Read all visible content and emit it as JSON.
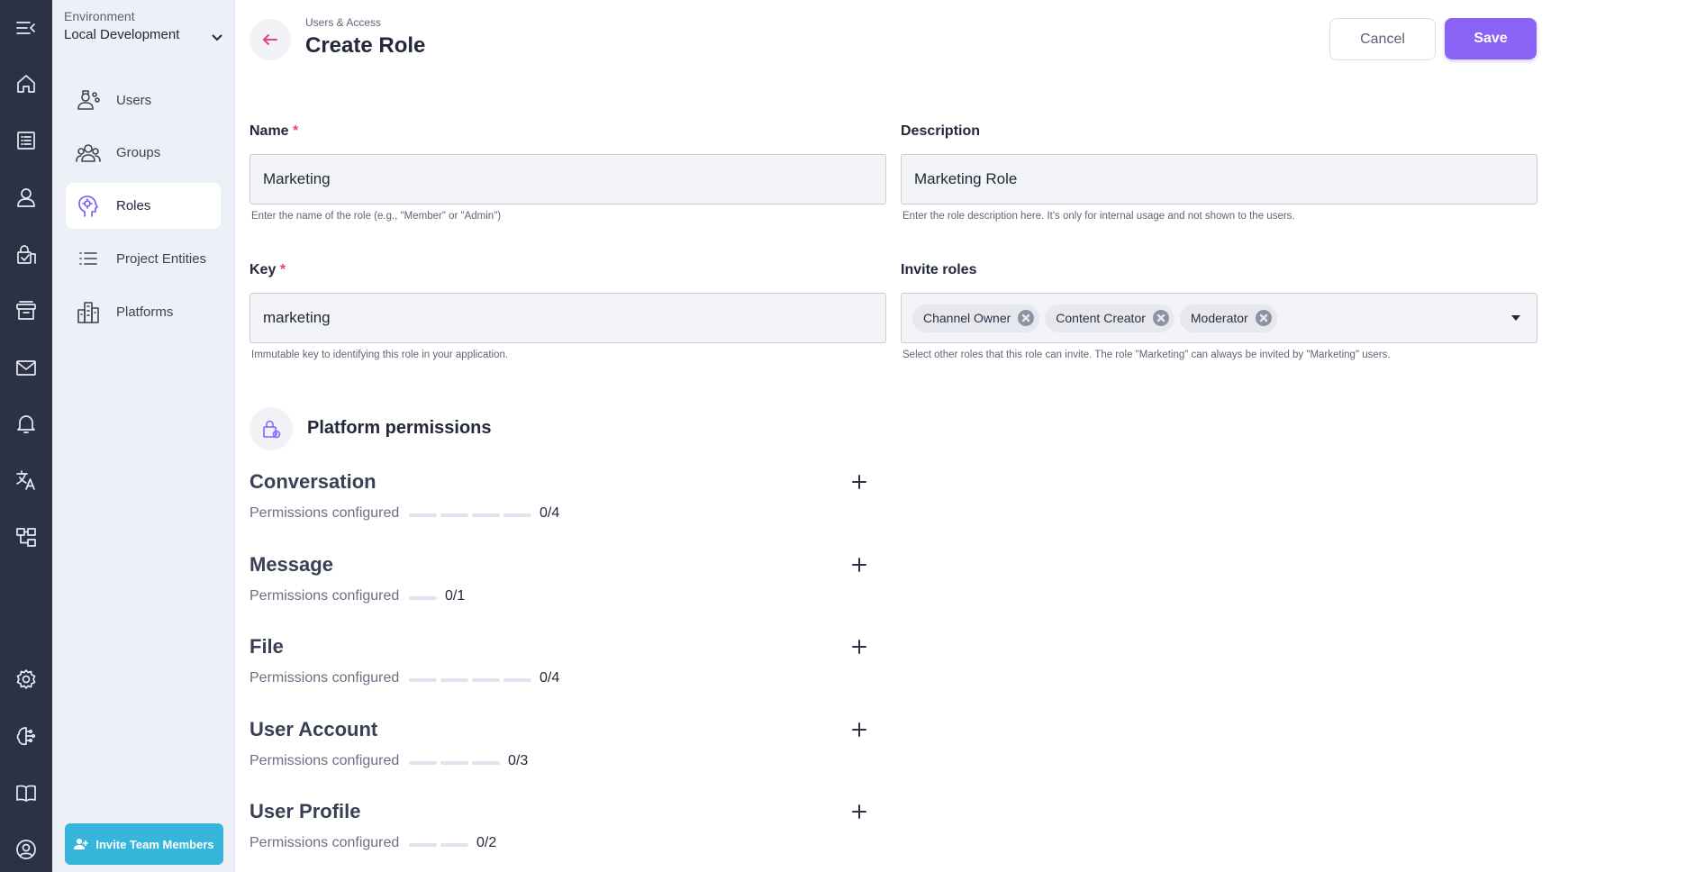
{
  "sidebar": {
    "environment_label": "Environment",
    "environment_value": "Local Development",
    "items": [
      {
        "label": "Users",
        "icon": "users-icon"
      },
      {
        "label": "Groups",
        "icon": "groups-icon"
      },
      {
        "label": "Roles",
        "icon": "roles-icon",
        "active": true
      },
      {
        "label": "Project Entities",
        "icon": "list-icon"
      },
      {
        "label": "Platforms",
        "icon": "building-icon"
      }
    ],
    "invite_label": "Invite Team Members"
  },
  "header": {
    "breadcrumb": "Users & Access",
    "title": "Create Role",
    "cancel_label": "Cancel",
    "save_label": "Save"
  },
  "form": {
    "name": {
      "label": "Name",
      "required": "*",
      "value": "Marketing",
      "hint": "Enter the name of the role (e.g., \"Member\" or \"Admin\")"
    },
    "description": {
      "label": "Description",
      "value": "Marketing Role",
      "hint": "Enter the role description here. It's only for internal usage and not shown to the users."
    },
    "key": {
      "label": "Key",
      "required": "*",
      "value": "marketing",
      "hint": "Immutable key to identifying this role in your application."
    },
    "invite_roles": {
      "label": "Invite roles",
      "chips": [
        "Channel Owner",
        "Content Creator",
        "Moderator"
      ],
      "hint": "Select other roles that this role can invite. The role \"Marketing\" can always be invited by \"Marketing\" users."
    }
  },
  "permissions": {
    "title": "Platform permissions",
    "sections": [
      {
        "title": "Conversation",
        "subtitle": "Permissions configured",
        "configured": 0,
        "total": 4,
        "count": "0/4"
      },
      {
        "title": "Message",
        "subtitle": "Permissions configured",
        "configured": 0,
        "total": 1,
        "count": "0/1"
      },
      {
        "title": "File",
        "subtitle": "Permissions configured",
        "configured": 0,
        "total": 4,
        "count": "0/4"
      },
      {
        "title": "User Account",
        "subtitle": "Permissions configured",
        "configured": 0,
        "total": 3,
        "count": "0/3"
      },
      {
        "title": "User Profile",
        "subtitle": "Permissions configured",
        "configured": 0,
        "total": 2,
        "count": "0/2"
      }
    ]
  },
  "colors": {
    "accent": "#8a63f5",
    "rail": "#2b3246",
    "invite": "#37b6dc",
    "required": "#e7417a"
  }
}
